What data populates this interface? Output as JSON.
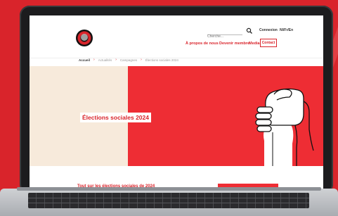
{
  "header": {
    "search": {
      "placeholder": "Cherche..."
    },
    "utility_links": [
      "Connexion",
      "Nl/Fr/En"
    ],
    "nav": [
      {
        "label": "À propos de nous"
      },
      {
        "label": "Devenir membre"
      },
      {
        "label": "Media"
      }
    ],
    "contact_label": "Contact"
  },
  "breadcrumb": [
    "Accueil",
    "Actualités",
    "Campagnes",
    "Élections sociales 2024"
  ],
  "hero": {
    "title": "Élections sociales 2024"
  },
  "section": {
    "title": "Tout sur les élections sociales de 2024"
  },
  "colors": {
    "brand_red": "#d9242b",
    "hero_red": "#ee2d34",
    "hero_cream": "#f7eadb"
  },
  "icons": [
    "search-icon",
    "logo",
    "fist-bump-illustration"
  ]
}
